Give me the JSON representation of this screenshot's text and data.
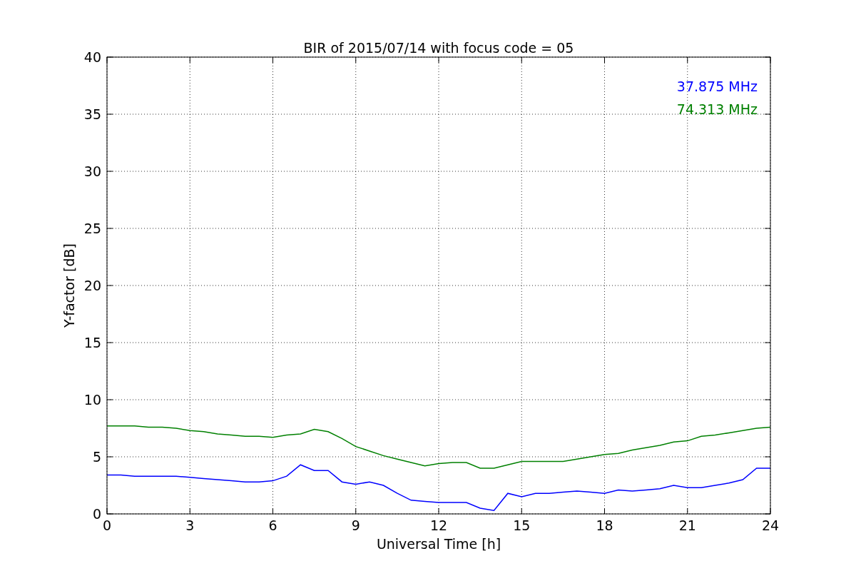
{
  "figure": {
    "chart_data": {
      "type": "line",
      "title": "BIR of 2015/07/14 with focus code = 05",
      "xlabel": "Universal Time [h]",
      "ylabel": "Y-factor [dB]",
      "x": [
        0,
        0.5,
        1,
        1.5,
        2,
        2.5,
        3,
        3.5,
        4,
        4.5,
        5,
        5.5,
        6,
        6.5,
        7,
        7.5,
        8,
        8.5,
        9,
        9.5,
        10,
        10.5,
        11,
        11.5,
        12,
        12.5,
        13,
        13.5,
        14,
        14.5,
        15,
        15.5,
        16,
        16.5,
        17,
        17.5,
        18,
        18.5,
        19,
        19.5,
        20,
        20.5,
        21,
        21.5,
        22,
        22.5,
        23,
        23.5,
        24
      ],
      "series": [
        {
          "name": "37.875 MHz",
          "color": "#0000ff",
          "values": [
            3.4,
            3.4,
            3.3,
            3.3,
            3.3,
            3.3,
            3.2,
            3.1,
            3.0,
            2.9,
            2.8,
            2.8,
            2.9,
            3.3,
            4.3,
            3.8,
            3.8,
            2.8,
            2.6,
            2.8,
            2.5,
            1.8,
            1.2,
            1.1,
            1.0,
            1.0,
            1.0,
            0.5,
            0.3,
            1.8,
            1.5,
            1.8,
            1.8,
            1.9,
            2.0,
            1.9,
            1.8,
            2.1,
            2.0,
            2.1,
            2.2,
            2.5,
            2.3,
            2.3,
            2.5,
            2.7,
            3.0,
            4.0,
            4.0
          ]
        },
        {
          "name": "74.313 MHz",
          "color": "#008000",
          "values": [
            7.7,
            7.7,
            7.7,
            7.6,
            7.6,
            7.5,
            7.3,
            7.2,
            7.0,
            6.9,
            6.8,
            6.8,
            6.7,
            6.9,
            7.0,
            7.4,
            7.2,
            6.6,
            5.9,
            5.5,
            5.1,
            4.8,
            4.5,
            4.2,
            4.4,
            4.5,
            4.5,
            4.0,
            4.0,
            4.3,
            4.6,
            4.6,
            4.6,
            4.6,
            4.8,
            5.0,
            5.2,
            5.3,
            5.6,
            5.8,
            6.0,
            6.3,
            6.4,
            6.8,
            6.9,
            7.1,
            7.3,
            7.5,
            7.6
          ]
        }
      ],
      "grid": true,
      "xlim": [
        0,
        24
      ],
      "ylim": [
        0,
        40
      ],
      "xticks": [
        0,
        3,
        6,
        9,
        12,
        15,
        18,
        21,
        24
      ],
      "yticks": [
        0,
        5,
        10,
        15,
        20,
        25,
        30,
        35,
        40
      ]
    }
  }
}
